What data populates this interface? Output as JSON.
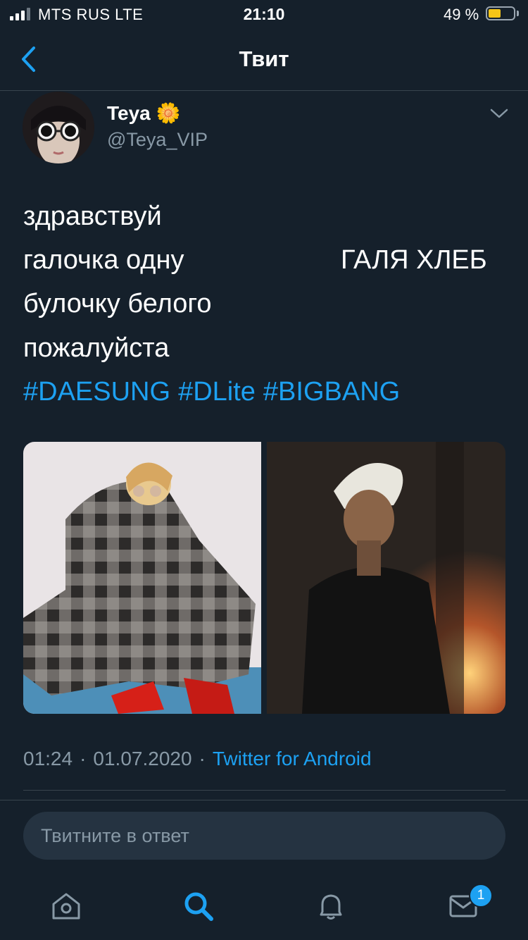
{
  "status_bar": {
    "carrier": "MTS RUS  LTE",
    "time": "21:10",
    "battery_percent": "49 %",
    "battery_level": 0.49,
    "battery_color": "#f5c518"
  },
  "nav": {
    "title": "Твит",
    "back_icon": "chevron-left-icon"
  },
  "tweet": {
    "author": {
      "display_name": "Teya",
      "emoji": "🌼",
      "handle": "@Teya_VIP"
    },
    "text_lines": [
      "здравствуй",
      "галочка одну",
      "булочку белого",
      "пожалуйста"
    ],
    "text_right": "ГАЛЯ ХЛЕБ",
    "hashtags": [
      "#DAESUNG",
      "#DLite",
      "#BIGBANG"
    ],
    "media": [
      {
        "description_icon": "photo-icon"
      },
      {
        "description_icon": "photo-icon"
      }
    ],
    "time": "01:24",
    "date": "01.07.2020",
    "source": "Twitter for Android",
    "separator": "·"
  },
  "reply": {
    "placeholder": "Твитните в ответ"
  },
  "tab_bar": {
    "items": [
      {
        "name": "home",
        "icon": "home-icon"
      },
      {
        "name": "search",
        "icon": "search-icon"
      },
      {
        "name": "notifications",
        "icon": "bell-icon"
      },
      {
        "name": "messages",
        "icon": "mail-icon",
        "badge": "1"
      }
    ]
  },
  "colors": {
    "background": "#15202b",
    "accent": "#1da1f2",
    "secondary_text": "#8899a6",
    "divider": "#38444d"
  }
}
